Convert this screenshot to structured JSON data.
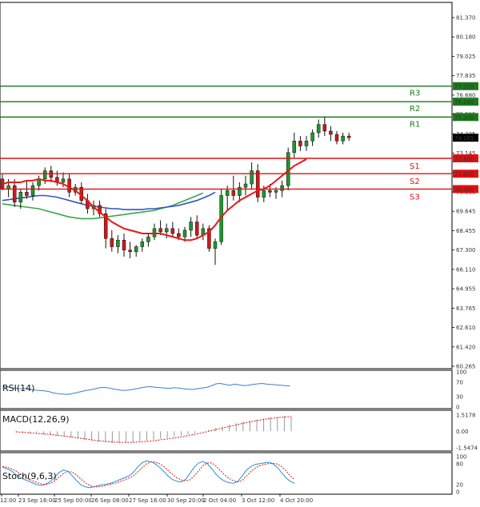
{
  "chart_data": {
    "type": "candlestick",
    "main": {
      "ylim": [
        60.265,
        81.37
      ],
      "y_ticks": [
        "81.370",
        "80.180",
        "79.025",
        "77.835",
        "76.680",
        "75.525",
        "74.335",
        "73.145",
        "71.990",
        "70.800",
        "69.645",
        "68.455",
        "67.300",
        "66.110",
        "64.955",
        "63.765",
        "62.610",
        "61.420",
        "60.265"
      ],
      "x_ticks": [
        "12:00",
        "23 Sep 16:00",
        "25 Sep 00:00",
        "26 Sep 08:00",
        "27 Sep 16:00",
        "30 Sep 20:00",
        "2 Oct 04:00",
        "3 Oct 12:00",
        "4 Oct 20:00"
      ],
      "current_price": "74.165",
      "levels": [
        {
          "name": "R3",
          "value": 77.22,
          "label": "77.220",
          "color": "#1a7a1a"
        },
        {
          "name": "R2",
          "value": 76.28,
          "label": "76.280",
          "color": "#1a7a1a"
        },
        {
          "name": "R1",
          "value": 75.35,
          "label": "75.350",
          "color": "#1a7a1a"
        },
        {
          "name": "S1",
          "value": 72.85,
          "label": "72.850",
          "color": "#e01010"
        },
        {
          "name": "S2",
          "value": 71.92,
          "label": "71.920",
          "color": "#e01010"
        },
        {
          "name": "S3",
          "value": 70.99,
          "label": "70.990",
          "color": "#e01010"
        }
      ],
      "candles": [
        {
          "o": 71.6,
          "h": 71.9,
          "l": 70.9,
          "c": 71.0
        },
        {
          "o": 71.0,
          "h": 71.6,
          "l": 70.5,
          "c": 71.2
        },
        {
          "o": 71.2,
          "h": 71.6,
          "l": 69.9,
          "c": 70.2
        },
        {
          "o": 70.2,
          "h": 71.0,
          "l": 69.8,
          "c": 70.8
        },
        {
          "o": 70.8,
          "h": 71.5,
          "l": 70.4,
          "c": 70.6
        },
        {
          "o": 70.6,
          "h": 71.4,
          "l": 70.3,
          "c": 71.2
        },
        {
          "o": 71.2,
          "h": 71.8,
          "l": 70.9,
          "c": 71.6
        },
        {
          "o": 71.6,
          "h": 72.3,
          "l": 71.3,
          "c": 72.1
        },
        {
          "o": 72.1,
          "h": 72.4,
          "l": 71.4,
          "c": 71.7
        },
        {
          "o": 71.7,
          "h": 72.1,
          "l": 71.2,
          "c": 71.4
        },
        {
          "o": 71.4,
          "h": 72.0,
          "l": 71.1,
          "c": 71.6
        },
        {
          "o": 71.6,
          "h": 71.9,
          "l": 70.5,
          "c": 70.8
        },
        {
          "o": 70.8,
          "h": 71.3,
          "l": 70.6,
          "c": 71.1
        },
        {
          "o": 71.1,
          "h": 71.4,
          "l": 70.1,
          "c": 70.3
        },
        {
          "o": 70.3,
          "h": 70.7,
          "l": 69.5,
          "c": 69.8
        },
        {
          "o": 69.8,
          "h": 70.3,
          "l": 69.4,
          "c": 70.0
        },
        {
          "o": 70.0,
          "h": 70.3,
          "l": 69.3,
          "c": 69.5
        },
        {
          "o": 69.5,
          "h": 69.8,
          "l": 67.4,
          "c": 68.0
        },
        {
          "o": 68.0,
          "h": 68.5,
          "l": 67.2,
          "c": 67.5
        },
        {
          "o": 67.5,
          "h": 68.2,
          "l": 67.1,
          "c": 67.9
        },
        {
          "o": 67.9,
          "h": 68.3,
          "l": 66.9,
          "c": 67.3
        },
        {
          "o": 67.3,
          "h": 67.8,
          "l": 66.8,
          "c": 67.2
        },
        {
          "o": 67.2,
          "h": 67.6,
          "l": 66.9,
          "c": 67.5
        },
        {
          "o": 67.5,
          "h": 68.0,
          "l": 67.2,
          "c": 67.8
        },
        {
          "o": 67.8,
          "h": 68.3,
          "l": 67.5,
          "c": 68.1
        },
        {
          "o": 68.1,
          "h": 68.9,
          "l": 67.9,
          "c": 68.6
        },
        {
          "o": 68.6,
          "h": 69.1,
          "l": 68.2,
          "c": 68.4
        },
        {
          "o": 68.4,
          "h": 68.9,
          "l": 68.0,
          "c": 68.6
        },
        {
          "o": 68.6,
          "h": 69.0,
          "l": 68.1,
          "c": 68.3
        },
        {
          "o": 68.3,
          "h": 68.6,
          "l": 67.9,
          "c": 68.1
        },
        {
          "o": 68.1,
          "h": 68.7,
          "l": 67.8,
          "c": 68.5
        },
        {
          "o": 68.5,
          "h": 69.3,
          "l": 68.1,
          "c": 69.0
        },
        {
          "o": 69.0,
          "h": 69.4,
          "l": 68.0,
          "c": 68.2
        },
        {
          "o": 68.2,
          "h": 68.9,
          "l": 67.9,
          "c": 68.6
        },
        {
          "o": 68.6,
          "h": 68.8,
          "l": 67.2,
          "c": 67.4
        },
        {
          "o": 67.4,
          "h": 68.0,
          "l": 66.4,
          "c": 67.8
        },
        {
          "o": 67.8,
          "h": 71.0,
          "l": 67.6,
          "c": 70.6
        },
        {
          "o": 70.6,
          "h": 71.2,
          "l": 69.7,
          "c": 70.9
        },
        {
          "o": 70.9,
          "h": 71.8,
          "l": 70.3,
          "c": 70.6
        },
        {
          "o": 70.6,
          "h": 71.4,
          "l": 70.2,
          "c": 71.1
        },
        {
          "o": 71.1,
          "h": 71.8,
          "l": 70.6,
          "c": 71.3
        },
        {
          "o": 71.3,
          "h": 72.6,
          "l": 71.0,
          "c": 72.1
        },
        {
          "o": 72.1,
          "h": 72.5,
          "l": 70.2,
          "c": 70.5
        },
        {
          "o": 70.5,
          "h": 71.2,
          "l": 70.2,
          "c": 70.9
        },
        {
          "o": 70.9,
          "h": 71.3,
          "l": 70.5,
          "c": 70.8
        },
        {
          "o": 70.8,
          "h": 71.1,
          "l": 70.4,
          "c": 70.9
        },
        {
          "o": 70.9,
          "h": 71.5,
          "l": 70.5,
          "c": 71.2
        },
        {
          "o": 71.2,
          "h": 73.5,
          "l": 70.9,
          "c": 73.2
        },
        {
          "o": 73.2,
          "h": 74.4,
          "l": 72.9,
          "c": 73.9
        },
        {
          "o": 73.9,
          "h": 74.2,
          "l": 73.3,
          "c": 73.6
        },
        {
          "o": 73.6,
          "h": 74.2,
          "l": 73.3,
          "c": 73.9
        },
        {
          "o": 73.9,
          "h": 74.6,
          "l": 73.6,
          "c": 74.4
        },
        {
          "o": 74.4,
          "h": 75.2,
          "l": 74.1,
          "c": 74.9
        },
        {
          "o": 74.9,
          "h": 75.4,
          "l": 74.2,
          "c": 74.5
        },
        {
          "o": 74.5,
          "h": 74.8,
          "l": 73.9,
          "c": 74.3
        },
        {
          "o": 74.3,
          "h": 74.5,
          "l": 73.7,
          "c": 73.9
        },
        {
          "o": 73.9,
          "h": 74.4,
          "l": 73.7,
          "c": 74.2
        },
        {
          "o": 74.2,
          "h": 74.4,
          "l": 73.9,
          "c": 74.1
        }
      ],
      "ma_red": [
        71.3,
        71.4,
        71.4,
        71.4,
        71.5,
        71.5,
        71.6,
        71.5,
        71.5,
        71.4,
        71.3,
        71.1,
        70.9,
        70.6,
        70.3,
        69.9,
        69.6,
        69.3,
        69.0,
        68.8,
        68.6,
        68.5,
        68.4,
        68.3,
        68.3,
        68.3,
        68.3,
        68.2,
        68.1,
        68.0,
        67.9,
        67.9,
        68.0,
        68.2,
        68.4,
        68.8,
        69.3,
        69.7,
        70.0,
        70.3,
        70.5,
        70.7,
        70.9,
        71.0,
        71.2,
        71.5,
        71.8,
        72.1,
        72.4,
        72.6,
        72.8
      ],
      "ma_blue": [
        70.3,
        70.35,
        70.4,
        70.45,
        70.5,
        70.55,
        70.6,
        70.6,
        70.55,
        70.5,
        70.4,
        70.3,
        70.2,
        70.1,
        70.0,
        69.95,
        69.9,
        69.85,
        69.8,
        69.8,
        69.75,
        69.75,
        69.75,
        69.75,
        69.8,
        69.8,
        69.85,
        69.9,
        69.95,
        70.0,
        70.1,
        70.2,
        70.3,
        70.45,
        70.6,
        70.8
      ],
      "ma_green": [
        70.1,
        70.05,
        70.0,
        69.95,
        69.9,
        69.85,
        69.8,
        69.7,
        69.6,
        69.5,
        69.4,
        69.3,
        69.25,
        69.2,
        69.2,
        69.2,
        69.25,
        69.3,
        69.35,
        69.4,
        69.45,
        69.5,
        69.55,
        69.6,
        69.65,
        69.7,
        69.8,
        69.9,
        70.0,
        70.15,
        70.3,
        70.45,
        70.6,
        70.75
      ]
    },
    "rsi": {
      "label": "RSI(14)",
      "ylim": [
        0,
        100
      ],
      "y_ticks": [
        "100",
        "70",
        "30",
        "0"
      ],
      "values": [
        58,
        57,
        55,
        53,
        52,
        53,
        50,
        48,
        47,
        46,
        44,
        40,
        38,
        37,
        36,
        38,
        41,
        44,
        47,
        49,
        52,
        55,
        56,
        54,
        51,
        49,
        47,
        48,
        50,
        52,
        55,
        57,
        58,
        56,
        55,
        54,
        53,
        55,
        54,
        52,
        51,
        50,
        52,
        54,
        56,
        60,
        66,
        67,
        64,
        62,
        65,
        63,
        61,
        62,
        64,
        66,
        67,
        65,
        64,
        63,
        62,
        61,
        60
      ]
    },
    "macd": {
      "label": "MACD(12,26,9)",
      "y_ticks": [
        "1.5178",
        "0.00",
        "-1.5474"
      ],
      "ylim": [
        -1.5474,
        1.5178
      ],
      "histogram": [
        -0.1,
        -0.15,
        -0.2,
        -0.25,
        -0.3,
        -0.35,
        -0.4,
        -0.5,
        -0.6,
        -0.7,
        -0.8,
        -0.9,
        -1.0,
        -1.05,
        -1.1,
        -1.1,
        -1.05,
        -1.0,
        -0.95,
        -0.9,
        -0.8,
        -0.7,
        -0.6,
        -0.5,
        -0.4,
        -0.3,
        -0.15,
        0.0,
        0.15,
        0.3,
        0.45,
        0.6,
        0.75,
        0.9,
        1.0,
        1.1,
        1.2,
        1.3,
        1.35,
        1.4,
        1.38
      ],
      "signal": [
        -0.05,
        -0.1,
        -0.15,
        -0.2,
        -0.25,
        -0.3,
        -0.37,
        -0.45,
        -0.53,
        -0.62,
        -0.7,
        -0.8,
        -0.88,
        -0.95,
        -1.0,
        -1.03,
        -1.04,
        -1.03,
        -1.0,
        -0.95,
        -0.88,
        -0.8,
        -0.72,
        -0.62,
        -0.52,
        -0.4,
        -0.28,
        -0.15,
        0.0,
        0.15,
        0.3,
        0.45,
        0.6,
        0.75,
        0.88,
        1.0,
        1.1,
        1.2,
        1.28,
        1.34,
        1.37
      ]
    },
    "stoch": {
      "label": "Stoch(9,6,3)",
      "ylim": [
        0,
        100
      ],
      "y_ticks": [
        "100",
        "80",
        "20",
        "0"
      ],
      "k": [
        70,
        66,
        60,
        50,
        42,
        35,
        30,
        25,
        20,
        18,
        22,
        30,
        42,
        55,
        62,
        58,
        46,
        32,
        20,
        14,
        12,
        14,
        18,
        20,
        22,
        25,
        30,
        35,
        40,
        45,
        55,
        70,
        82,
        88,
        86,
        80,
        70,
        58,
        45,
        35,
        30,
        28,
        35,
        52,
        70,
        82,
        86,
        80,
        66,
        50,
        38,
        30,
        26,
        24,
        30,
        45,
        62,
        72,
        78,
        80,
        82,
        84,
        80,
        70,
        55,
        40,
        30,
        24
      ],
      "d": [
        72,
        70,
        66,
        60,
        52,
        44,
        37,
        31,
        26,
        22,
        21,
        24,
        31,
        42,
        52,
        58,
        56,
        48,
        36,
        26,
        18,
        14,
        14,
        16,
        19,
        22,
        25,
        29,
        34,
        39,
        45,
        56,
        68,
        79,
        85,
        85,
        80,
        72,
        61,
        50,
        40,
        34,
        31,
        34,
        45,
        60,
        74,
        82,
        82,
        73,
        60,
        48,
        38,
        31,
        28,
        33,
        45,
        58,
        68,
        74,
        78,
        80,
        81,
        79,
        72,
        60,
        46,
        35
      ]
    }
  }
}
